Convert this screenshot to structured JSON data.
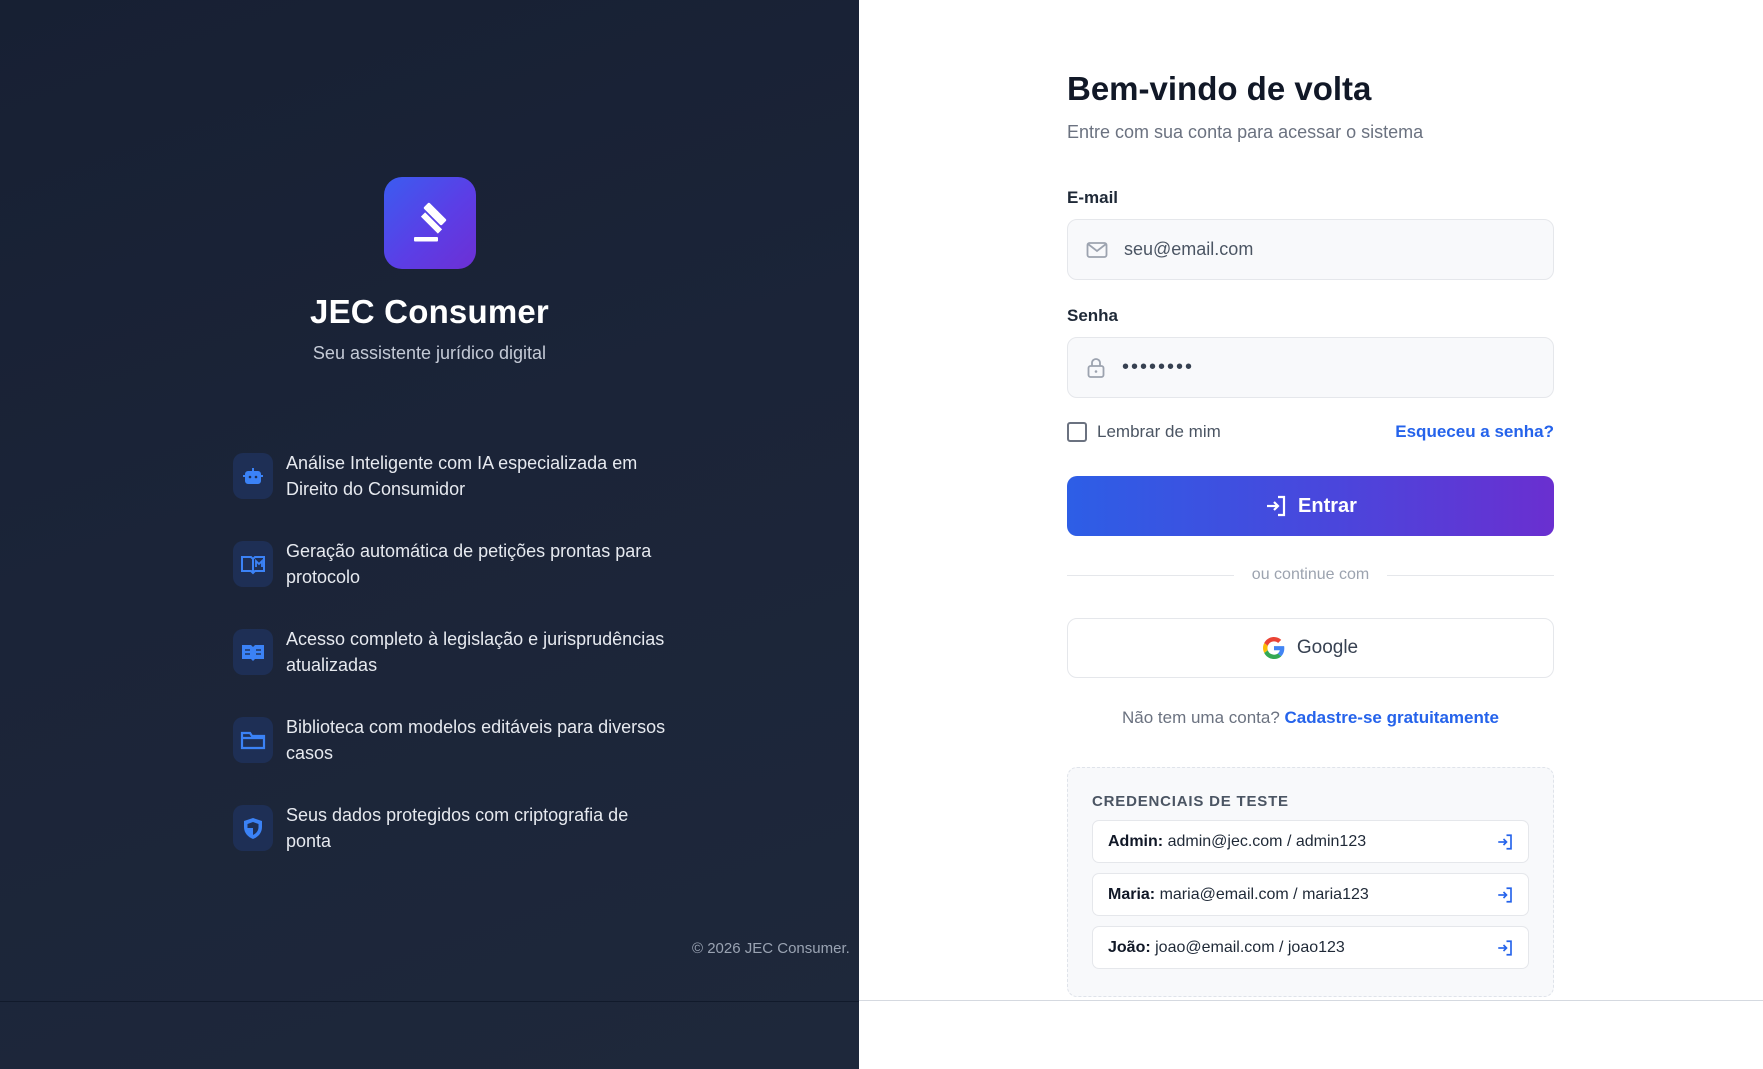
{
  "brand": {
    "name": "JEC Consumer",
    "tagline": "Seu assistente jurídico digital",
    "logo_icon": "gavel-icon",
    "logo_gradient": [
      "#3b5cf0",
      "#6d2fd4"
    ]
  },
  "features": [
    {
      "icon": "robot-icon",
      "text": "Análise Inteligente com IA especializada em Direito do Consumidor"
    },
    {
      "icon": "open-book-icon",
      "text": "Geração automática de petições prontas para protocolo"
    },
    {
      "icon": "book-icon",
      "text": "Acesso completo à legislação e jurisprudências atualizadas"
    },
    {
      "icon": "folder-icon",
      "text": "Biblioteca com modelos editáveis para diversos casos"
    },
    {
      "icon": "shield-icon",
      "text": "Seus dados protegidos com criptografia de ponta"
    }
  ],
  "copyright": "© 2026 JEC Consumer.",
  "login": {
    "title": "Bem-vindo de volta",
    "subtitle": "Entre com sua conta para acessar o sistema",
    "email_label": "E-mail",
    "email_placeholder": "seu@email.com",
    "password_label": "Senha",
    "password_value": "••••••••",
    "remember_label": "Lembrar de mim",
    "forgot_label": "Esqueceu a senha?",
    "submit_label": "Entrar",
    "divider_text": "ou continue com",
    "google_label": "Google",
    "signup_prompt": "Não tem uma conta?",
    "signup_link": "Cadastre-se gratuitamente"
  },
  "test_credentials": {
    "title": "CREDENCIAIS DE TESTE",
    "items": [
      {
        "name": "Admin:",
        "value": "admin@jec.com / admin123"
      },
      {
        "name": "Maria:",
        "value": "maria@email.com / maria123"
      },
      {
        "name": "João:",
        "value": "joao@email.com / joao123"
      }
    ]
  },
  "colors": {
    "accent": "#2563eb",
    "left_bg": "#1b2438",
    "button_gradient_start": "#2d5ee6",
    "button_gradient_end": "#6a2fd0"
  }
}
